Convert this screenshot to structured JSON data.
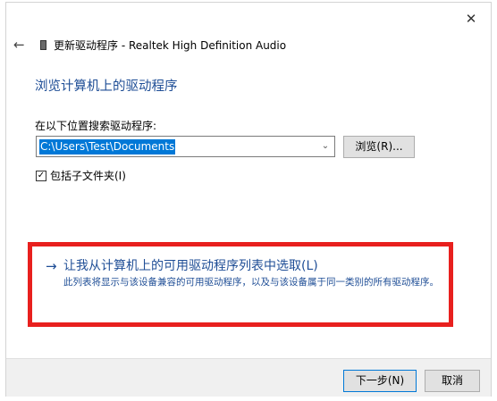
{
  "window": {
    "close_glyph": "✕"
  },
  "nav": {
    "back_glyph": "←",
    "title": "更新驱动程序 - Realtek High Definition Audio"
  },
  "page": {
    "heading": "浏览计算机上的驱动程序",
    "search_label": "在以下位置搜索驱动程序:",
    "path_value": "C:\\Users\\Test\\Documents",
    "combo_arrow_glyph": "⌄",
    "browse_label": "浏览(R)...",
    "include_subfolders_label": "包括子文件夹(I)",
    "include_subfolders_checked": true,
    "checkbox_glyph": "✓"
  },
  "pick_option": {
    "arrow_glyph": "→",
    "title": "让我从计算机上的可用驱动程序列表中选取(L)",
    "description": "此列表将显示与该设备兼容的可用驱动程序，以及与该设备属于同一类别的所有驱动程序。"
  },
  "footer": {
    "next_label": "下一步(N)",
    "cancel_label": "取消"
  },
  "colors": {
    "heading_blue": "#1f4e96",
    "highlight_red": "#e8201e",
    "selection_blue": "#0078d7"
  }
}
